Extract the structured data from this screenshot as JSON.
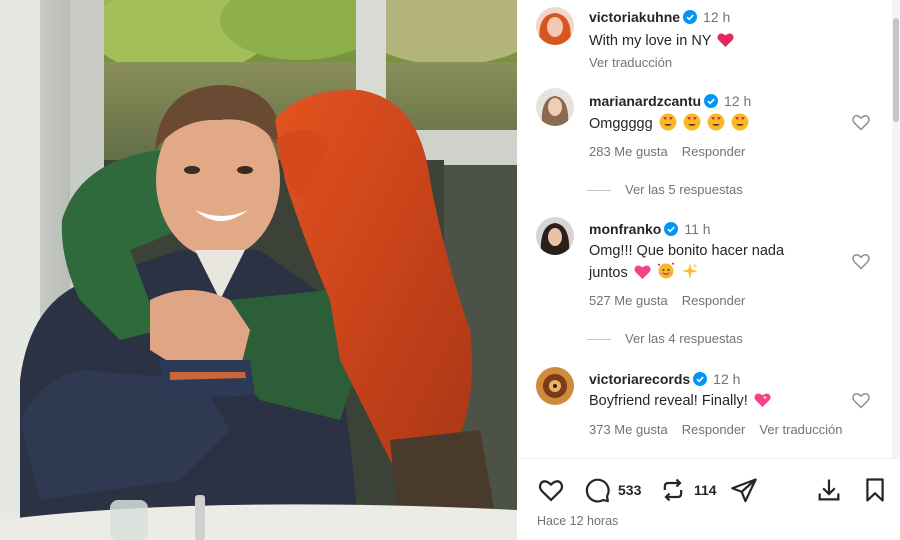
{
  "caption": {
    "username": "victoriakuhne",
    "time": "12 h",
    "text": "With my love in NY",
    "translate": "Ver traducción"
  },
  "comments": [
    {
      "username": "marianardzcantu",
      "time": "12 h",
      "text": "Omggggg",
      "emojis": [
        "heart-eyes-emoji",
        "heart-eyes-emoji",
        "heart-eyes-emoji",
        "heart-eyes-emoji"
      ],
      "likes": "283 Me gusta",
      "reply": "Responder",
      "view_replies": "Ver las 5 respuestas"
    },
    {
      "username": "monfranko",
      "time": "11 h",
      "text_line1": "Omg!!! Que bonito hacer nada",
      "text_line2": "juntos",
      "emojis": [
        "pink-heart-emoji",
        "smiling-hearts-emoji",
        "sparkles-emoji"
      ],
      "likes": "527 Me gusta",
      "reply": "Responder",
      "view_replies": "Ver las 4 respuestas"
    },
    {
      "username": "victoriarecords",
      "time": "12 h",
      "text": "Boyfriend reveal! Finally!",
      "emojis": [
        "sparkling-heart-emoji"
      ],
      "likes": "373 Me gusta",
      "reply": "Responder",
      "translate": "Ver traducción"
    }
  ],
  "actions": {
    "comments_count": "533",
    "reposts_count": "114",
    "posted": "Hace 12 horas"
  },
  "colors": {
    "verified": "#0095f6",
    "heart_emoji": "#e8265e",
    "muted_text": "#737373"
  }
}
